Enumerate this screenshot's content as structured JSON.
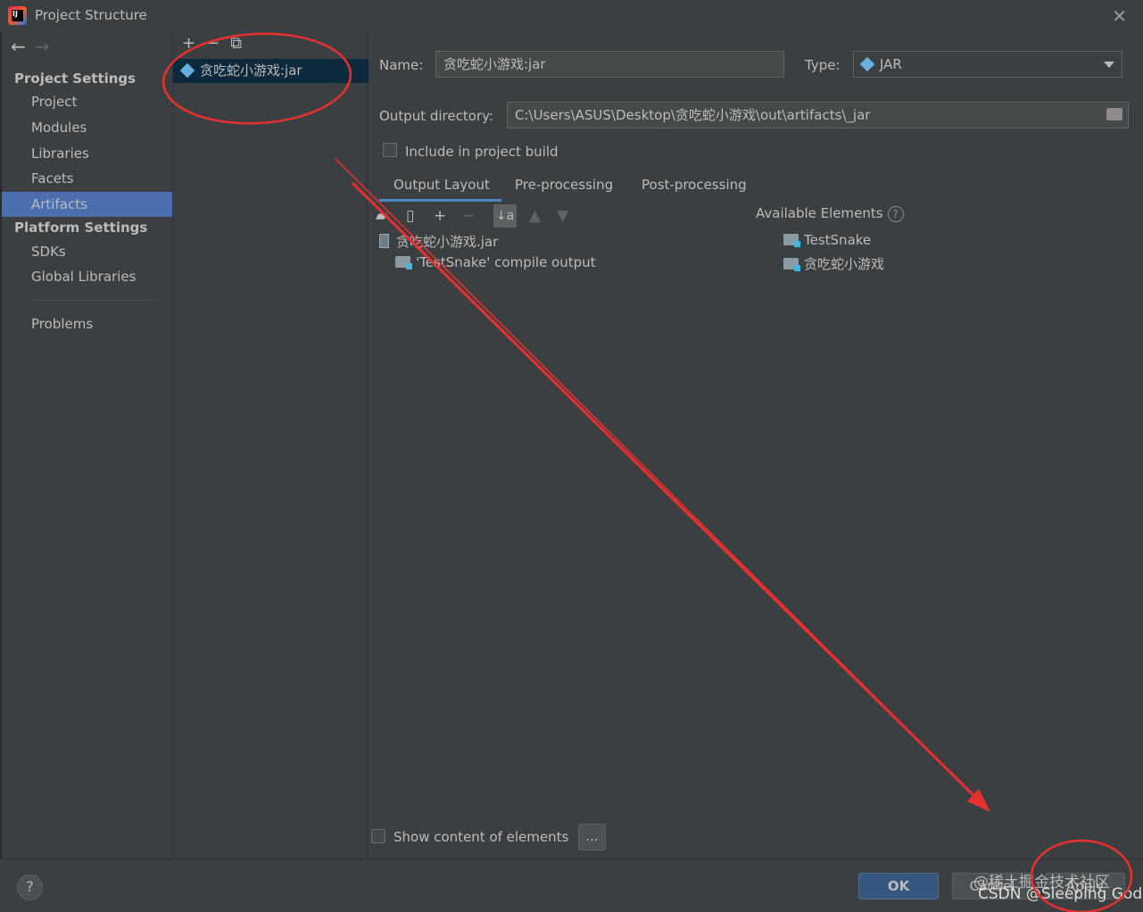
{
  "window": {
    "title": "Project Structure"
  },
  "sidebar": {
    "project_settings_header": "Project Settings",
    "project_items": [
      "Project",
      "Modules",
      "Libraries",
      "Facets",
      "Artifacts"
    ],
    "platform_settings_header": "Platform Settings",
    "platform_items": [
      "SDKs",
      "Global Libraries"
    ],
    "problems": "Problems",
    "selected": "Artifacts"
  },
  "artifacts": {
    "items": [
      "贪吃蛇小游戏:jar"
    ]
  },
  "form": {
    "name_label": "Name:",
    "name_value": "贪吃蛇小游戏:jar",
    "type_label": "Type:",
    "type_value": "JAR",
    "output_label": "Output directory:",
    "output_value": "C:\\Users\\ASUS\\Desktop\\贪吃蛇小游戏\\out\\artifacts\\_jar",
    "include_build": "Include in project build"
  },
  "tabs": [
    "Output Layout",
    "Pre-processing",
    "Post-processing"
  ],
  "layout_tree": [
    "贪吃蛇小游戏.jar",
    "'TestSnake' compile output"
  ],
  "available": {
    "header": "Available Elements",
    "items": [
      "TestSnake",
      "贪吃蛇小游戏"
    ]
  },
  "show_content": "Show content of elements",
  "dots_label": "...",
  "footer": {
    "help": "?",
    "ok": "OK",
    "cancel": "Cancel",
    "apply": "Apply"
  },
  "watermark": {
    "line1": "@稀土掘金技术社区",
    "line2": "CSDN @Sleeping God"
  },
  "annotation_color": "#e8302f"
}
